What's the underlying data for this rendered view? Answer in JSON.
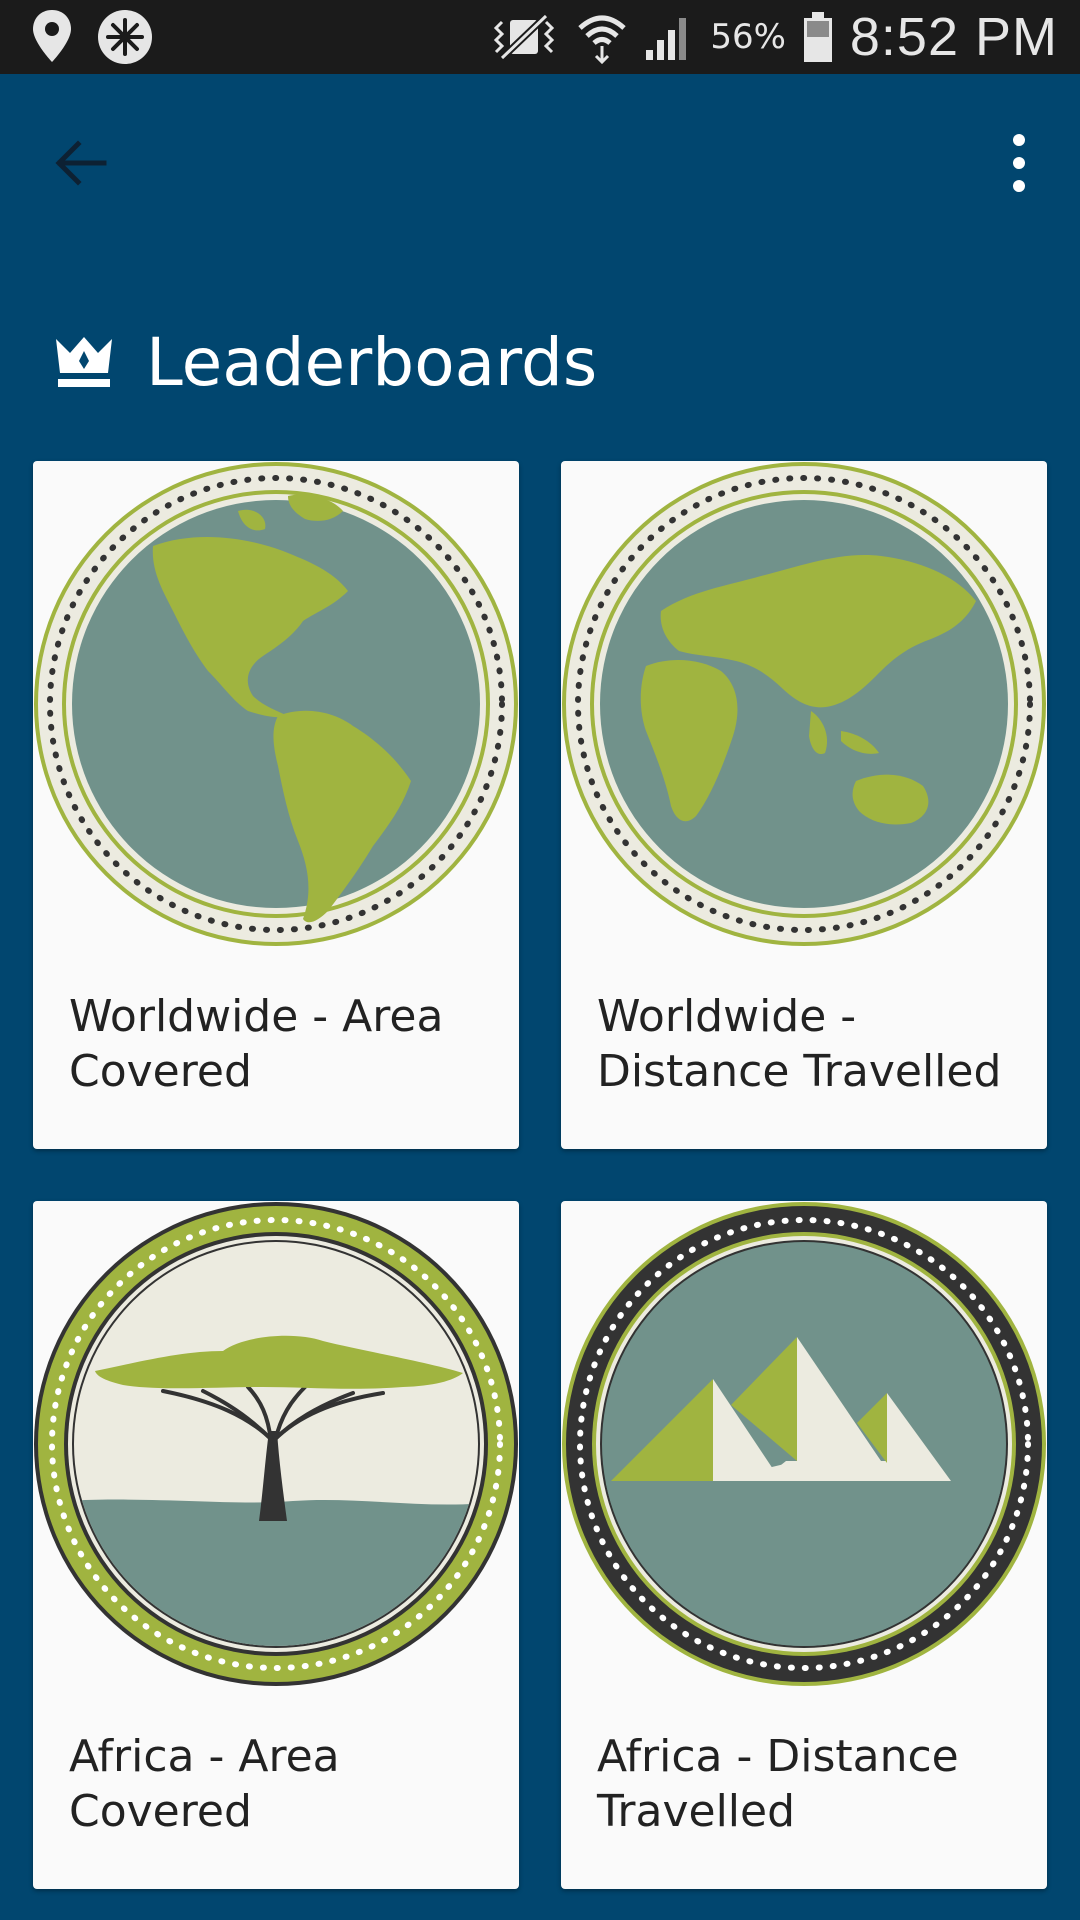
{
  "status_bar": {
    "battery_percent": "56%",
    "time": "8:52 PM",
    "left_icons": [
      "location-pin-icon",
      "compass-app-icon"
    ],
    "right_icons": [
      "vibrate-icon",
      "wifi-icon",
      "signal-icon",
      "battery-icon"
    ]
  },
  "app_bar": {
    "back_icon": "arrow-back-icon",
    "menu_icon": "more-vert-icon"
  },
  "heading": {
    "icon": "crown-icon",
    "title": "Leaderboards"
  },
  "colors": {
    "background": "#01466f",
    "card": "#fafafa",
    "badge_green": "#a0b440",
    "badge_slate": "#71928b",
    "badge_cream": "#ecebe0",
    "badge_dark": "#333333"
  },
  "cards": [
    {
      "label": "Worldwide - Area Covered",
      "badge": "globe-americas-badge"
    },
    {
      "label": "Worldwide - Distance Travelled",
      "badge": "globe-eurasia-badge"
    },
    {
      "label": "Africa - Area Covered",
      "badge": "acacia-tree-badge"
    },
    {
      "label": "Africa - Distance Travelled",
      "badge": "pyramids-badge"
    }
  ]
}
